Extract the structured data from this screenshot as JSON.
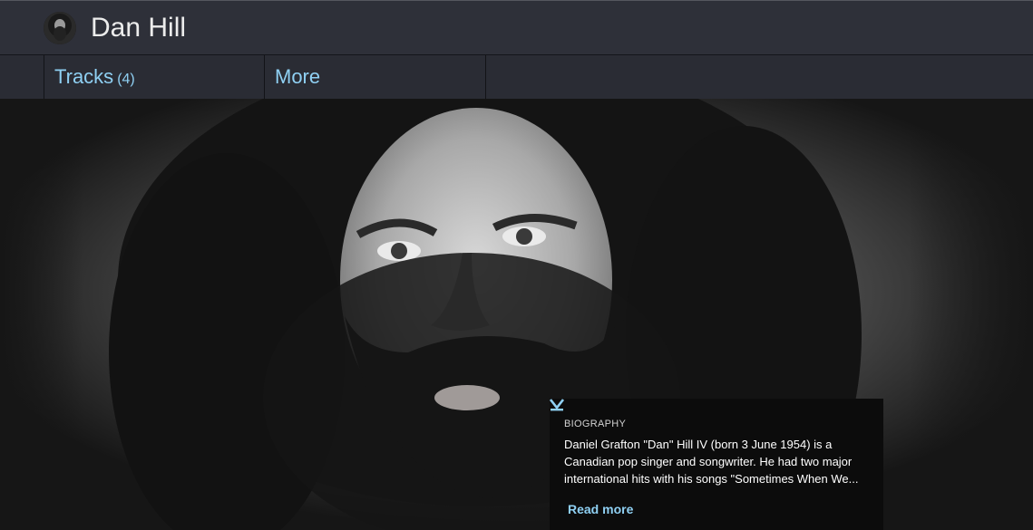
{
  "header": {
    "artist_name": "Dan Hill",
    "avatar_icon": "artist-avatar"
  },
  "nav": {
    "tabs": [
      {
        "label": "Tracks",
        "count": "(4)"
      },
      {
        "label": "More"
      }
    ]
  },
  "hero": {
    "image": "artist-portrait-photo"
  },
  "biography": {
    "label": "BIOGRAPHY",
    "text": "Daniel Grafton \"Dan\" Hill IV (born 3 June 1954) is a Canadian pop singer and songwriter. He had two major international hits with his songs \"Sometimes When We...",
    "read_more": "Read more",
    "read_more_icon": "chevron-down-icon"
  },
  "colors": {
    "header_bg": "#2e3039",
    "nav_bg": "#2a2c34",
    "accent": "#8fd0f3",
    "bio_bg": "#0c0c0c"
  }
}
